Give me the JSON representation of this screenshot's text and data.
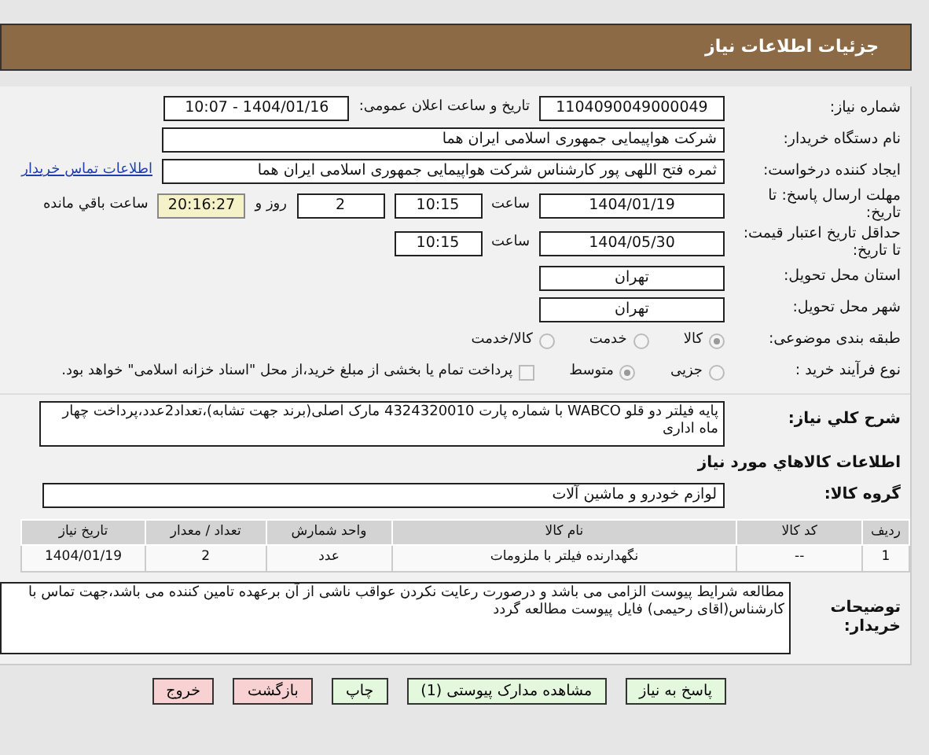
{
  "header": {
    "title": "جزئیات اطلاعات نیاز"
  },
  "rows": [
    {
      "label": "شماره نیاز:",
      "items": [
        {
          "kind": "field",
          "value": "1104090049000049"
        },
        {
          "kind": "text",
          "value": "تاریخ و ساعت اعلان عمومی:"
        },
        {
          "kind": "field",
          "value": "1404/01/16 - 10:07"
        }
      ]
    },
    {
      "label": "نام دستگاه خریدار:",
      "items": [
        {
          "kind": "wide",
          "value": "شرکت هواپیمایی جمهوری اسلامی ایران هما"
        }
      ]
    },
    {
      "label": "ایجاد کننده درخواست:",
      "items": [
        {
          "kind": "wide",
          "value": "ثمره فتح اللهی پور کارشناس شرکت هواپیمایی جمهوری اسلامی ایران هما"
        },
        {
          "kind": "link",
          "value": "اطلاعات تماس خریدار"
        }
      ]
    },
    {
      "label": "مهلت ارسال پاسخ: تا تاریخ:",
      "items": [
        {
          "kind": "field",
          "value": "1404/01/19"
        },
        {
          "kind": "text",
          "value": "ساعت"
        },
        {
          "kind": "short",
          "value": "10:15"
        },
        {
          "kind": "short",
          "value": "2"
        },
        {
          "kind": "text",
          "value": "روز و"
        },
        {
          "kind": "timer",
          "value": "20:16:27"
        },
        {
          "kind": "text",
          "value": "ساعت باقي مانده"
        }
      ]
    },
    {
      "label": "حداقل تاریخ اعتبار قیمت: تا تاریخ:",
      "items": [
        {
          "kind": "field",
          "value": "1404/05/30"
        },
        {
          "kind": "text",
          "value": "ساعت"
        },
        {
          "kind": "short",
          "value": "10:15"
        }
      ]
    },
    {
      "label": "استان محل تحویل:",
      "items": [
        {
          "kind": "field",
          "value": "تهران"
        }
      ]
    },
    {
      "label": "شهر محل تحویل:",
      "items": [
        {
          "kind": "field",
          "value": "تهران"
        }
      ]
    },
    {
      "label": "طبقه بندی موضوعی:",
      "items": [
        {
          "kind": "radio",
          "value": "کالا",
          "selected": true
        },
        {
          "kind": "radio",
          "value": "خدمت",
          "selected": false
        },
        {
          "kind": "radio",
          "value": "کالا/خدمت",
          "selected": false
        }
      ]
    },
    {
      "label": "نوع فرآیند خرید :",
      "items": [
        {
          "kind": "radio",
          "value": "جزیی",
          "selected": false
        },
        {
          "kind": "radio",
          "value": "متوسط",
          "selected": true
        },
        {
          "kind": "checkbox",
          "value": "پرداخت تمام یا بخشی از مبلغ خرید،از محل \"اسناد خزانه اسلامی\" خواهد بود.",
          "checked": false
        }
      ]
    }
  ],
  "need": {
    "label": "شرح کلي نیاز:",
    "value": "پایه فیلتر دو قلو WABCO با شماره پارت 4324320010 مارک اصلی(برند جهت تشابه)،تعداد2عدد،پرداخت چهار ماه اداری"
  },
  "goods_title": "اطلاعات کالاهاي مورد نیاز",
  "group": {
    "label": "گروه کالا:",
    "value": "لوازم خودرو و ماشین آلات"
  },
  "table": {
    "columns": [
      "ردیف",
      "کد کالا",
      "نام کالا",
      "واحد شمارش",
      "تعداد / معدار",
      "تاریخ نیاز"
    ],
    "rows": [
      [
        "1",
        "--",
        "نگهدارنده فیلتر با ملزومات",
        "عدد",
        "2",
        "1404/01/19"
      ]
    ]
  },
  "notes": {
    "label": "توضیحات خریدار:",
    "value": "مطالعه شرایط پیوست الزامی می باشد و درصورت رعایت نکردن عواقب ناشی از آن برعهده تامین کننده می باشد،جهت تماس با کارشناس(اقای رحیمی) فایل پیوست مطالعه گردد"
  },
  "buttons": [
    {
      "label": "پاسخ به نیاز",
      "kind": "primary"
    },
    {
      "label": "مشاهده مدارک پیوستی (1)",
      "kind": "primary"
    },
    {
      "label": "چاپ",
      "kind": "primary"
    },
    {
      "label": "بازگشت",
      "kind": "danger"
    },
    {
      "label": "خروج",
      "kind": "danger"
    }
  ]
}
